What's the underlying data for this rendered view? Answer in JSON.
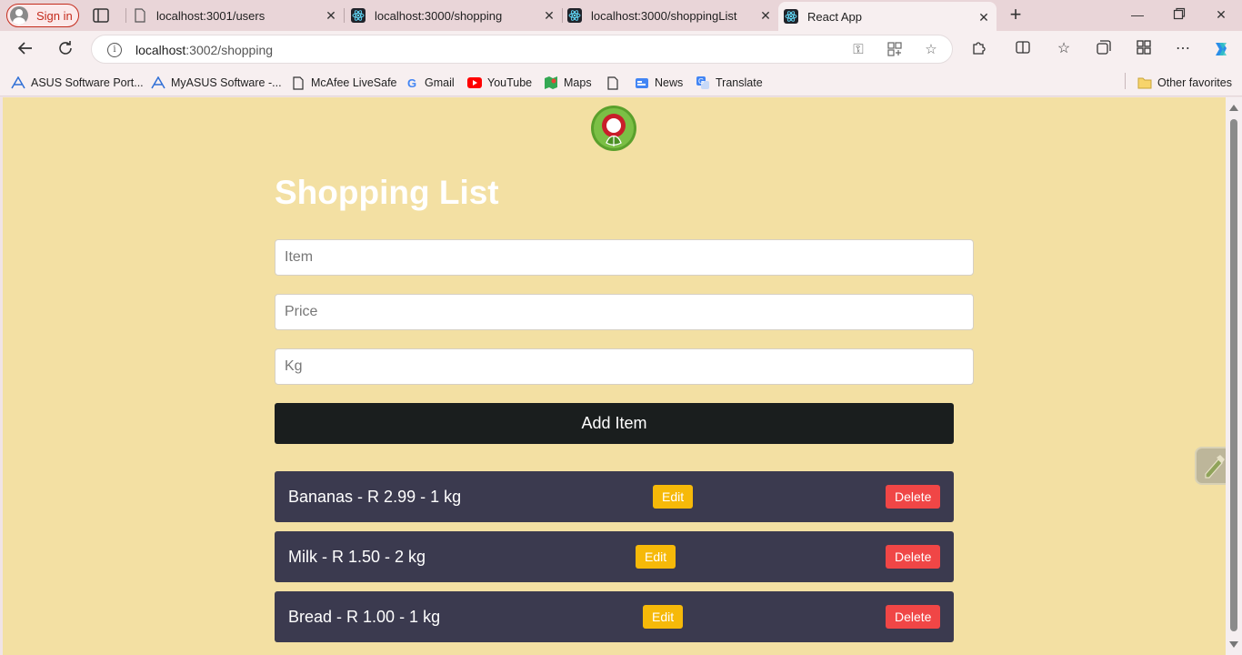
{
  "browser": {
    "signin_label": "Sign in",
    "tabs": [
      {
        "title": "localhost:3001/users",
        "icon": "page-icon"
      },
      {
        "title": "localhost:3000/shopping",
        "icon": "react-icon"
      },
      {
        "title": "localhost:3000/shoppingList",
        "icon": "react-icon"
      },
      {
        "title": "React App",
        "icon": "react-icon",
        "active": true
      }
    ],
    "address": {
      "host": "localhost",
      "path": ":3002/shopping"
    },
    "favorites": [
      {
        "label": "ASUS Software Port...",
        "icon": "asus-icon"
      },
      {
        "label": "MyASUS Software -...",
        "icon": "asus-icon"
      },
      {
        "label": "McAfee LiveSafe",
        "icon": "page-icon"
      },
      {
        "label": "Gmail",
        "icon": "google-icon"
      },
      {
        "label": "YouTube",
        "icon": "youtube-icon"
      },
      {
        "label": "Maps",
        "icon": "maps-icon"
      },
      {
        "label": "News",
        "icon": "news-icon"
      },
      {
        "label": "Translate",
        "icon": "translate-icon"
      }
    ],
    "other_favorites": "Other favorites"
  },
  "page": {
    "title": "Shopping List",
    "inputs": {
      "item_placeholder": "Item",
      "price_placeholder": "Price",
      "kg_placeholder": "Kg"
    },
    "add_button": "Add Item",
    "items": [
      {
        "text": "Bananas - R 2.99 - 1 kg",
        "edit": "Edit",
        "delete": "Delete"
      },
      {
        "text": "Milk - R 1.50 - 2 kg",
        "edit": "Edit",
        "delete": "Delete"
      },
      {
        "text": "Bread - R 1.00 - 1 kg",
        "edit": "Edit",
        "delete": "Delete"
      }
    ]
  },
  "colors": {
    "page_background": "#f3e0a3",
    "button_dark": "#1a1e1e",
    "row_background": "#3b3a4f",
    "edit_button": "#f6b909",
    "delete_button": "#f04646"
  }
}
